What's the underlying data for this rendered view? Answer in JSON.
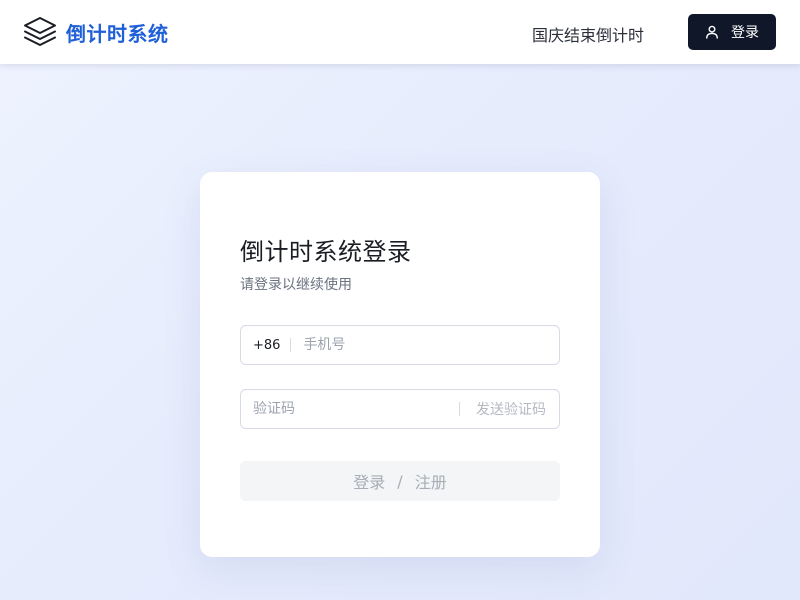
{
  "header": {
    "logo_title": "倒计时系统",
    "nav_text": "国庆结束倒计时",
    "login_button": "登录",
    "logo_icon": "stacked-layers-icon",
    "user_icon": "user-icon"
  },
  "card": {
    "title": "倒计时系统登录",
    "subtitle": "请登录以继续使用",
    "phone": {
      "prefix": "+86",
      "placeholder": "手机号",
      "value": ""
    },
    "code": {
      "placeholder": "验证码",
      "value": "",
      "send_label": "发送验证码"
    },
    "submit": {
      "login_label": "登录",
      "separator": "/",
      "register_label": "注册"
    }
  },
  "colors": {
    "brand": "#1f5fd8",
    "dark_button": "#0f1729",
    "background": "#e6ecfc"
  }
}
